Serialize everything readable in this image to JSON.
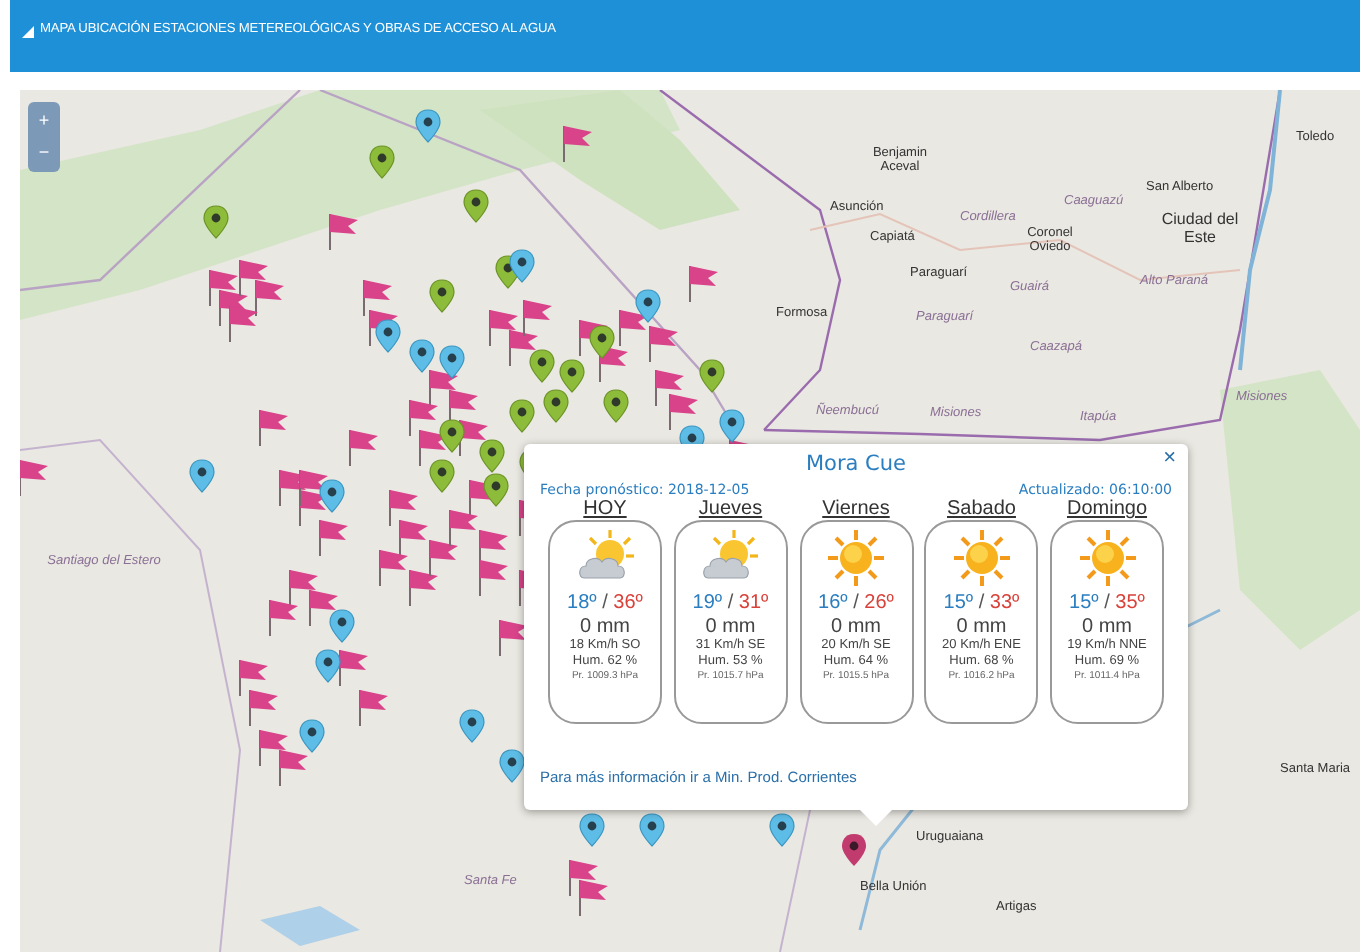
{
  "header": {
    "title": "MAPA UBICACIÓN ESTACIONES METEREOLÓGICAS Y OBRAS DE ACCESO AL AGUA"
  },
  "zoom_controls": {
    "zoom_in": "+",
    "zoom_out": "−"
  },
  "map_labels": [
    {
      "text": "Benjamin Aceval",
      "kind": "city"
    },
    {
      "text": "Asunción",
      "kind": "city"
    },
    {
      "text": "Capiatá",
      "kind": "city"
    },
    {
      "text": "Cordillera",
      "kind": "region"
    },
    {
      "text": "Caaguazú",
      "kind": "region"
    },
    {
      "text": "Coronel Oviedo",
      "kind": "city"
    },
    {
      "text": "Paraguarí",
      "kind": "city"
    },
    {
      "text": "Guairá",
      "kind": "region"
    },
    {
      "text": "San Alberto",
      "kind": "city"
    },
    {
      "text": "Ciudad del Este",
      "kind": "bigcity"
    },
    {
      "text": "Alto Paraná",
      "kind": "region"
    },
    {
      "text": "Toledo",
      "kind": "city"
    },
    {
      "text": "Formosa",
      "kind": "city"
    },
    {
      "text": "Paraguarí",
      "kind": "region"
    },
    {
      "text": "Caazapá",
      "kind": "region"
    },
    {
      "text": "Itapúa",
      "kind": "region"
    },
    {
      "text": "Misiones",
      "kind": "region"
    },
    {
      "text": "Ñeembucú",
      "kind": "region"
    },
    {
      "text": "Misiones",
      "kind": "region"
    },
    {
      "text": "Santiago del Estero",
      "kind": "region"
    },
    {
      "text": "Santa Fe",
      "kind": "region"
    },
    {
      "text": "Santa Maria",
      "kind": "city"
    },
    {
      "text": "Uruguaiana",
      "kind": "city"
    },
    {
      "text": "Bella Unión",
      "kind": "city"
    },
    {
      "text": "Artigas",
      "kind": "city"
    }
  ],
  "popup": {
    "station": "Mora Cue",
    "close": "×",
    "forecast_date": "Fecha pronóstico: 2018-12-05",
    "updated": "Actualizado: 06:10:00",
    "days": [
      {
        "name": "HOY",
        "kind": "partly_cloudy",
        "min": "18º",
        "sep": "/",
        "max": "36º",
        "rain": "0 mm",
        "wind": "18 Km/h SO",
        "humidity": "Hum. 62 %",
        "pressure": "Pr. 1009.3 hPa"
      },
      {
        "name": "Jueves",
        "kind": "partly_cloudy",
        "min": "19º",
        "sep": "/",
        "max": "31º",
        "rain": "0 mm",
        "wind": "31 Km/h SE",
        "humidity": "Hum. 53 %",
        "pressure": "Pr. 1015.7 hPa"
      },
      {
        "name": "Viernes",
        "kind": "sunny",
        "min": "16º",
        "sep": "/",
        "max": "26º",
        "rain": "0 mm",
        "wind": "20 Km/h SE",
        "humidity": "Hum. 64 %",
        "pressure": "Pr. 1015.5 hPa"
      },
      {
        "name": "Sabado",
        "kind": "sunny",
        "min": "15º",
        "sep": "/",
        "max": "33º",
        "rain": "0 mm",
        "wind": "20 Km/h ENE",
        "humidity": "Hum. 68 %",
        "pressure": "Pr. 1016.2 hPa"
      },
      {
        "name": "Domingo",
        "kind": "sunny",
        "min": "15º",
        "sep": "/",
        "max": "35º",
        "rain": "0 mm",
        "wind": "19 Km/h NNE",
        "humidity": "Hum. 69 %",
        "pressure": "Pr. 1011.4 hPa"
      }
    ],
    "link": "Para más información ir a Min. Prod. Corrientes"
  }
}
